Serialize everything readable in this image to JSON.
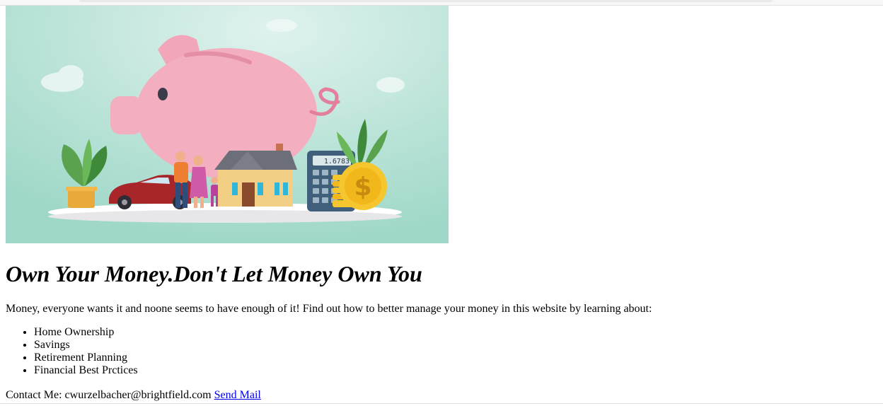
{
  "page": {
    "title": "Own Your Money.Don't Let Money Own You",
    "intro": "Money, everyone wants it and noone seems to have enough of it! Find out how to better manage your money in this website by learning about:",
    "topics": [
      "Home Ownership",
      "Savings",
      "Retirement Planning",
      "Financial Best Prctices"
    ],
    "contact_label": "Contact Me: cwurzelbacher@brightfield.com",
    "mail_link_text": "Send Mail"
  },
  "hero": {
    "calculator_display": "1.6783",
    "coin_symbol": "$",
    "icon_name": "piggy-bank-finance-illustration"
  },
  "colors": {
    "link": "#0000ee",
    "hero_background": "#a9dccd",
    "piggy": "#f3aebf"
  }
}
